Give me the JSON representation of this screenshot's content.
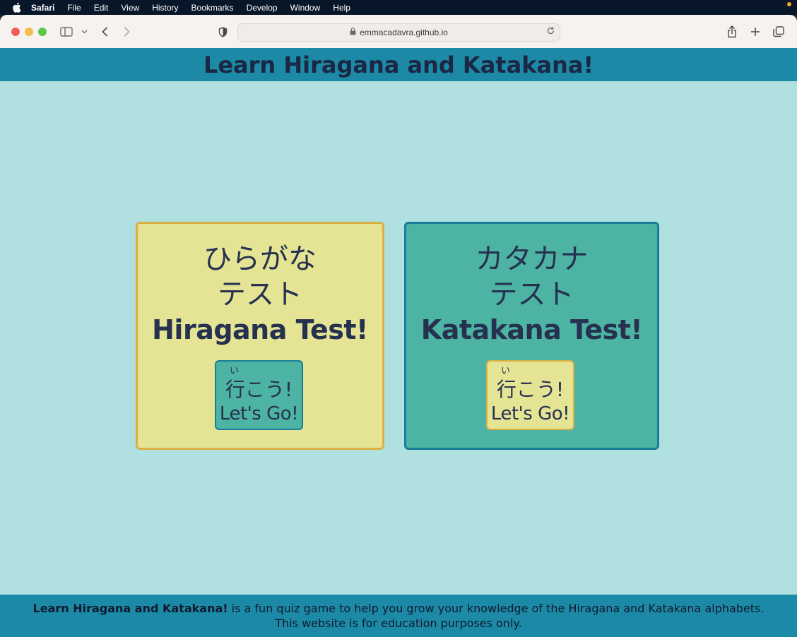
{
  "menubar": {
    "app": "Safari",
    "items": [
      "File",
      "Edit",
      "View",
      "History",
      "Bookmarks",
      "Develop",
      "Window",
      "Help"
    ]
  },
  "browser": {
    "url": "emmacadavra.github.io"
  },
  "site": {
    "title": "Learn Hiragana and Katakana!",
    "cards": [
      {
        "jp_line1": "ひらがな",
        "jp_line2": "テスト",
        "en": "Hiragana Test!",
        "button_ruby": "い",
        "button_jp": "行こう!",
        "button_en": "Let's Go!"
      },
      {
        "jp_line1": "カタカナ",
        "jp_line2": "テスト",
        "en": "Katakana Test!",
        "button_ruby": "い",
        "button_jp": "行こう!",
        "button_en": "Let's Go!"
      }
    ],
    "footer": {
      "bold": "Learn Hiragana and Katakana!",
      "text": " is a fun quiz game to help you grow your knowledge of the Hiragana and Katakana alphabets.",
      "line2": "This website is for education purposes only."
    }
  },
  "colors": {
    "header": "#1c8aa6",
    "page_bg": "#b0e0e0",
    "hiragana_card": "#e4e494",
    "katakana_card": "#4db3a3",
    "text": "#263150"
  },
  "icons": [
    "apple-icon",
    "sidebar-icon",
    "chevron-down-icon",
    "back-icon",
    "forward-icon",
    "shield-icon",
    "lock-icon",
    "reload-icon",
    "share-icon",
    "new-tab-icon",
    "tabs-overview-icon"
  ]
}
